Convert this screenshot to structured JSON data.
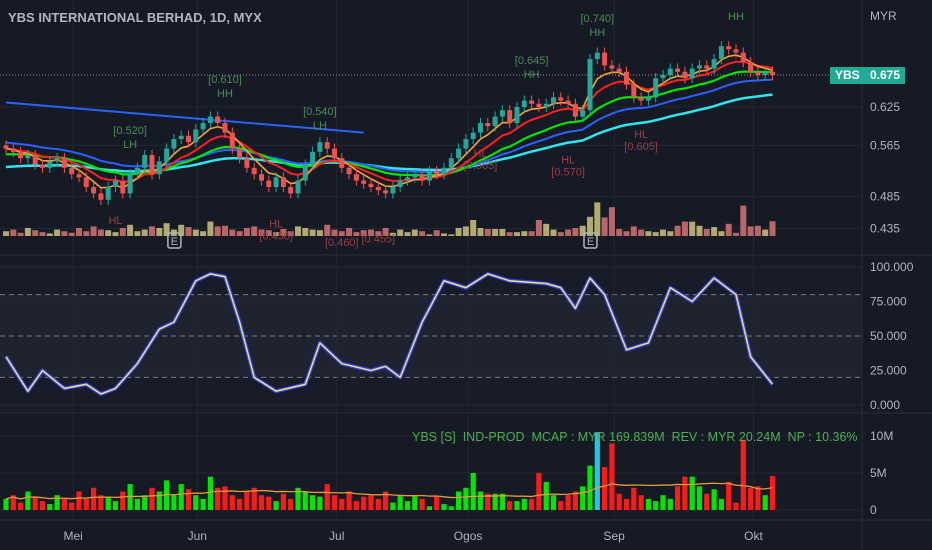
{
  "header": {
    "title": "YBS INTERNATIONAL BERHAD, 1D, MYX"
  },
  "price_axis": {
    "currency": "MYR",
    "ticks": [
      "0.625",
      "0.565",
      "0.485",
      "0.435"
    ],
    "tag_symbol": "YBS",
    "tag_price": "0.675"
  },
  "osc_axis": {
    "ticks": [
      "100.000",
      "75.000",
      "50.000",
      "25.000",
      "0.000"
    ]
  },
  "vol_axis": {
    "ticks": [
      "10M",
      "5M",
      "0"
    ]
  },
  "time_axis": {
    "labels": [
      "Mei",
      "Jun",
      "Jul",
      "Ogos",
      "Sep",
      "Okt"
    ]
  },
  "legend": {
    "text": "YBS [S]  IND-PROD  MCAP : MYR 169.839M  REV : MYR 20.24M  NP : 10.36%"
  },
  "earnings_marker": "E",
  "colors": {
    "up": "#26a69a",
    "down": "#ef5350",
    "bg": "#161a25",
    "tag": "#22ab94",
    "vol_up": "#00e600",
    "vol_down": "#ff1a1a",
    "vol_highlight": "#1ec8e6"
  },
  "chart_data": {
    "type": "candlestick",
    "title": "YBS INTERNATIONAL BERHAD, 1D, MYX",
    "ylabel": "MYR",
    "ylim": [
      0.42,
      0.76
    ],
    "month_bar_index": {
      "Mei": 9.2,
      "Jun": 26.2,
      "Jul": 45.3,
      "Ogos": 63.3,
      "Sep": 83.3,
      "Okt": 102.4
    },
    "close": [
      0.56,
      0.555,
      0.545,
      0.55,
      0.535,
      0.53,
      0.54,
      0.545,
      0.53,
      0.52,
      0.515,
      0.5,
      0.49,
      0.48,
      0.5,
      0.51,
      0.49,
      0.52,
      0.53,
      0.55,
      0.52,
      0.54,
      0.56,
      0.575,
      0.58,
      0.57,
      0.59,
      0.6,
      0.61,
      0.6,
      0.585,
      0.56,
      0.545,
      0.53,
      0.52,
      0.51,
      0.5,
      0.515,
      0.5,
      0.49,
      0.51,
      0.535,
      0.555,
      0.57,
      0.56,
      0.545,
      0.53,
      0.52,
      0.51,
      0.505,
      0.5,
      0.495,
      0.49,
      0.5,
      0.51,
      0.515,
      0.52,
      0.51,
      0.525,
      0.52,
      0.53,
      0.545,
      0.56,
      0.575,
      0.585,
      0.6,
      0.595,
      0.61,
      0.62,
      0.6,
      0.625,
      0.635,
      0.63,
      0.625,
      0.63,
      0.64,
      0.635,
      0.63,
      0.61,
      0.62,
      0.7,
      0.71,
      0.69,
      0.685,
      0.68,
      0.66,
      0.64,
      0.635,
      0.64,
      0.67,
      0.675,
      0.685,
      0.68,
      0.67,
      0.685,
      0.69,
      0.685,
      0.7,
      0.72,
      0.715,
      0.71,
      0.695,
      0.68,
      0.675,
      0.68,
      0.675
    ],
    "volume_m": [
      1.5,
      2,
      1,
      2.5,
      1.8,
      1.2,
      0.8,
      2,
      1.5,
      1,
      2.5,
      1.5,
      3,
      2,
      1.8,
      1.2,
      2.5,
      3.5,
      1.5,
      2,
      3,
      2.5,
      4,
      2,
      3.5,
      2.8,
      2,
      1.5,
      4.5,
      3,
      3.2,
      2,
      1.5,
      2.5,
      3,
      2,
      1.8,
      1.2,
      2.2,
      1.5,
      3,
      2.5,
      2,
      1.8,
      3.5,
      2,
      1.5,
      2.5,
      1.2,
      1.8,
      2,
      1.5,
      2.5,
      1,
      2,
      1.2,
      2,
      1.5,
      0.5,
      1.8,
      0.8,
      0.5,
      2.5,
      3,
      5,
      2.5,
      2.2,
      2.2,
      2.2,
      1.2,
      1.2,
      1.5,
      1.5,
      5,
      3.8,
      2,
      1.2,
      2,
      2.5,
      3.2,
      6,
      10.5,
      5.8,
      9,
      2.2,
      1.5,
      3,
      2,
      1.5,
      1.2,
      2,
      1.5,
      3.2,
      4.5,
      4.5,
      3.2,
      2.2,
      2.8,
      1.5,
      3.8,
      1,
      9.5,
      3,
      3.2,
      2,
      4.6
    ],
    "volume_highlight_index": 81,
    "volume_ylim": [
      0,
      11
    ],
    "stochastic": [
      [
        0,
        35
      ],
      [
        3,
        10
      ],
      [
        5,
        25
      ],
      [
        8,
        12
      ],
      [
        11,
        15
      ],
      [
        13,
        8
      ],
      [
        15,
        12
      ],
      [
        18,
        30
      ],
      [
        21,
        55
      ],
      [
        23,
        60
      ],
      [
        26,
        90
      ],
      [
        28,
        95
      ],
      [
        30,
        93
      ],
      [
        32,
        60
      ],
      [
        34,
        20
      ],
      [
        37,
        10
      ],
      [
        41,
        15
      ],
      [
        43,
        45
      ],
      [
        46,
        30
      ],
      [
        50,
        25
      ],
      [
        52,
        28
      ],
      [
        54,
        20
      ],
      [
        57,
        60
      ],
      [
        60,
        90
      ],
      [
        63,
        85
      ],
      [
        66,
        95
      ],
      [
        69,
        90
      ],
      [
        74,
        88
      ],
      [
        76,
        85
      ],
      [
        78,
        70
      ],
      [
        80,
        92
      ],
      [
        82,
        80
      ],
      [
        85,
        40
      ],
      [
        88,
        45
      ],
      [
        91,
        85
      ],
      [
        94,
        75
      ],
      [
        97,
        92
      ],
      [
        100,
        80
      ],
      [
        102,
        35
      ],
      [
        105,
        15
      ]
    ],
    "stoch_levels": [
      80,
      50,
      20
    ],
    "trendline": [
      [
        0,
        0.632
      ],
      [
        49,
        0.585
      ]
    ],
    "earnings_bars": [
      23,
      80
    ],
    "annotations": [
      {
        "bar": 17,
        "price": 0.545,
        "label": "[0.520]",
        "tag": "LH",
        "side": "high"
      },
      {
        "bar": 30,
        "price": 0.625,
        "label": "[0.610]",
        "tag": "HH",
        "side": "high"
      },
      {
        "bar": 43,
        "price": 0.575,
        "label": "[0.540]",
        "tag": "LH",
        "side": "high"
      },
      {
        "bar": 72,
        "price": 0.655,
        "label": "[0.645]",
        "tag": "HH",
        "side": "high"
      },
      {
        "bar": 81,
        "price": 0.72,
        "label": "[0.740]",
        "tag": "HH",
        "side": "high"
      },
      {
        "bar": 100,
        "price": 0.745,
        "label": "",
        "tag": "HH",
        "side": "high"
      },
      {
        "bar": 15,
        "price": 0.47,
        "label": "",
        "tag": "HL",
        "side": "low"
      },
      {
        "bar": 37,
        "price": 0.465,
        "label": "[0.450]",
        "tag": "HL",
        "side": "low"
      },
      {
        "bar": 46,
        "price": 0.455,
        "label": "[0.460]",
        "tag": "",
        "side": "low"
      },
      {
        "bar": 51,
        "price": 0.46,
        "label": "[0.455]",
        "tag": "",
        "side": "low"
      },
      {
        "bar": 65,
        "price": 0.575,
        "label": "[0.565]",
        "tag": "HL",
        "side": "low"
      },
      {
        "bar": 77,
        "price": 0.565,
        "label": "[0.570]",
        "tag": "HL",
        "side": "low"
      },
      {
        "bar": 87,
        "price": 0.605,
        "label": "[0.605]",
        "tag": "HL",
        "side": "low"
      }
    ]
  }
}
